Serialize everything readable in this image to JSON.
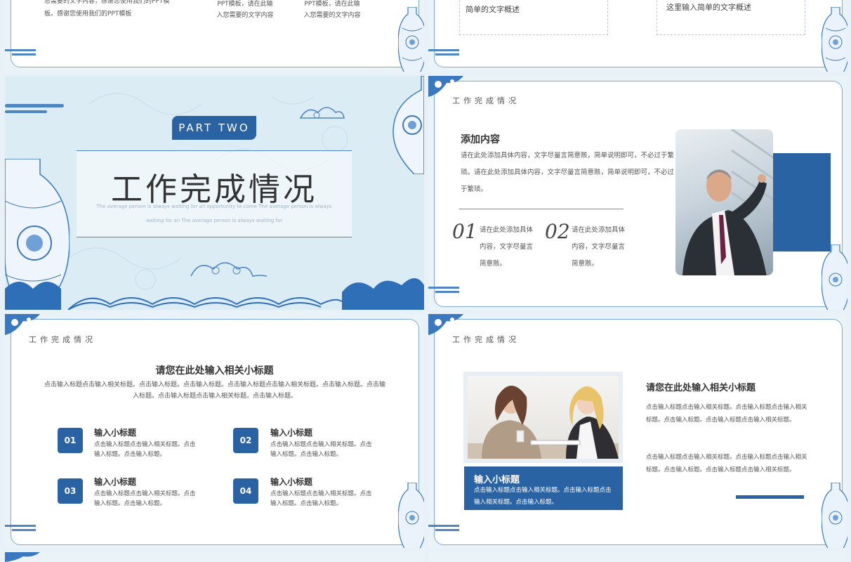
{
  "s1": {
    "col1": "恳需要的文字内容，感谢您使用我们的PPT模板。感谢您使用我们的PPT模板",
    "col2": "PPT模板，请在此输入您需要的文字内容",
    "col3": "PPT模板，请在此输入您需要的文字内容"
  },
  "s2": {
    "left": "简单的文字概述",
    "right": "这里输入简单的文字概述"
  },
  "s3": {
    "part": "PART TWO",
    "title": "工作完成情况",
    "desc1": "The average person is always waiting for an opportunity to come The average person is always",
    "desc2": "waiting for an The average person is always waiting for"
  },
  "s4": {
    "section": "工作完成情况",
    "heading": "添加内容",
    "para": "请在此处添加具体内容，文字尽量言简意赅，简单说明即可，不必过于繁琐。请在此处添加具体内容，文字尽量言简意赅，简单说明即可，不必过于繁琐。",
    "items": [
      {
        "num": "01",
        "text": "请在此处添加具体内容，文字尽量言简意赅。"
      },
      {
        "num": "02",
        "text": "请在此处添加具体内容，文字尽量言简意赅。"
      }
    ]
  },
  "s5": {
    "section": "工作完成情况",
    "heading": "请您在此处输入相关小标题",
    "para": "点击输入标题点击输入相关标题。点击输入标题。点击输入标题。点击输入标题点击输入相关标题。点击输入标题。点击输入标题。点击输入标题点击输入相关标题。点击输入标题。",
    "items": [
      {
        "num": "01",
        "title": "输入小标题",
        "text": "点击输入标题点击输入相关标题。点击输入标题。点击输入标题。"
      },
      {
        "num": "02",
        "title": "输入小标题",
        "text": "点击输入标题点击输入相关标题。点击输入标题。点击输入标题。"
      },
      {
        "num": "03",
        "title": "输入小标题",
        "text": "点击输入标题点击输入相关标题。点击输入标题。点击输入标题。"
      },
      {
        "num": "04",
        "title": "输入小标题",
        "text": "点击输入标题点击输入相关标题。点击输入标题。点击输入标题。"
      }
    ]
  },
  "s6": {
    "section": "工作完成情况",
    "heading": "请您在此处输入相关小标题",
    "para1": "点击输入标题点击输入相关标题。点击输入标题点击输入相关标题。点击输入标题。点击输入标题点击输入相关标题。",
    "para2": "点击输入标题点击输入相关标题。点击输入标题点击输入相关标题。点击输入标题。点击输入标题点击输入相关标题。",
    "box_title": "输入小标题",
    "box_text": "点击输入标题点击输入相关标题。点击输入标题点击输入相关标题。点击输入标题。"
  }
}
